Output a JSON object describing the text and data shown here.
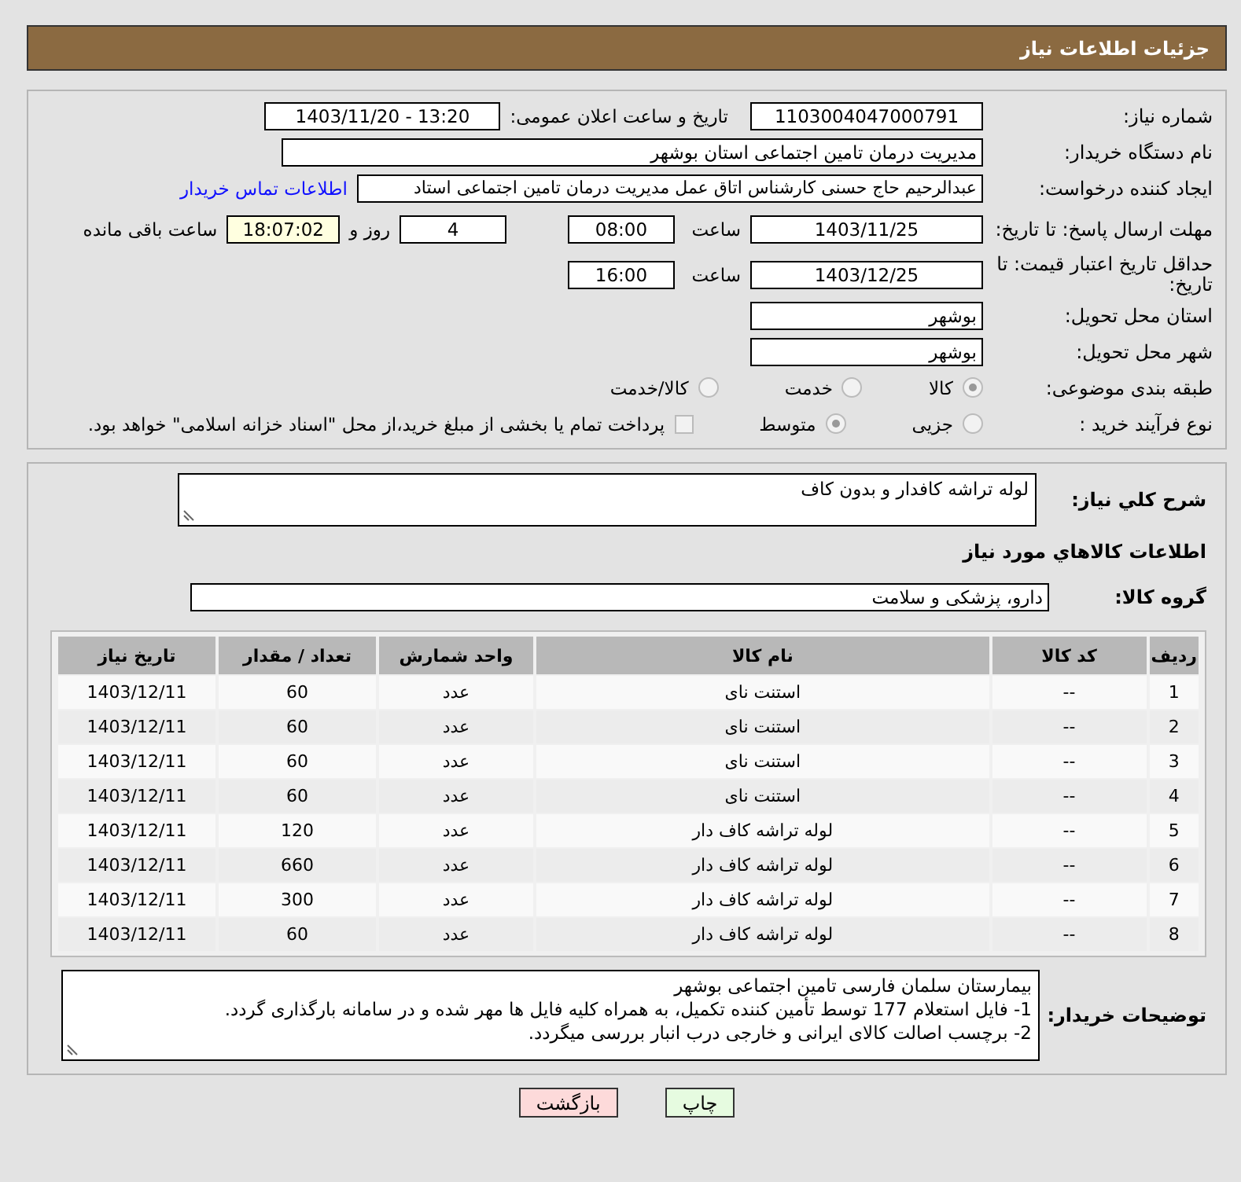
{
  "header": {
    "title": "جزئیات اطلاعات نیاز"
  },
  "form": {
    "need_number": {
      "label": "شماره نیاز:",
      "value": "1103004047000791"
    },
    "announce": {
      "label": "تاریخ و ساعت اعلان عمومی:",
      "value": "1403/11/20 - 13:20"
    },
    "buyer_org": {
      "label": "نام دستگاه خریدار:",
      "value": "مدیریت درمان تامین اجتماعی استان بوشهر"
    },
    "creator": {
      "label": "ایجاد کننده درخواست:",
      "value": "عبدالرحیم حاج حسنی کارشناس اتاق عمل مدیریت درمان تامین اجتماعی استاد",
      "link": "اطلاعات تماس خریدار"
    },
    "deadline": {
      "label": "مهلت ارسال پاسخ: تا تاریخ:",
      "date": "1403/11/25",
      "time_label": "ساعت",
      "time": "08:00",
      "days": "4",
      "days_label": "روز و",
      "remaining": "18:07:02",
      "remaining_label": "ساعت باقی مانده"
    },
    "validity": {
      "label": "حداقل تاریخ اعتبار قیمت: تا تاریخ:",
      "date": "1403/12/25",
      "time_label": "ساعت",
      "time": "16:00"
    },
    "province": {
      "label": "استان محل تحویل:",
      "value": "بوشهر"
    },
    "city": {
      "label": "شهر محل تحویل:",
      "value": "بوشهر"
    },
    "category": {
      "label": "طبقه بندی موضوعی:",
      "options": [
        {
          "label": "کالا",
          "selected": true
        },
        {
          "label": "خدمت",
          "selected": false
        },
        {
          "label": "کالا/خدمت",
          "selected": false
        }
      ]
    },
    "process": {
      "label": "نوع فرآیند خرید :",
      "options": [
        {
          "label": "جزیی",
          "selected": false
        },
        {
          "label": "متوسط",
          "selected": true
        }
      ],
      "treasury": {
        "label": "پرداخت تمام یا بخشی از مبلغ خرید،از محل \"اسناد خزانه اسلامی\" خواهد بود.",
        "checked": false
      }
    }
  },
  "details": {
    "description": {
      "label": "شرح كلي نياز:",
      "value": "لوله تراشه کافدار و بدون کاف"
    },
    "goods_heading": "اطلاعات كالاهاي مورد نياز",
    "group": {
      "label": "گروه کالا:",
      "value": "دارو، پزشکی و سلامت"
    },
    "table": {
      "columns": [
        "ردیف",
        "کد کالا",
        "نام کالا",
        "واحد شمارش",
        "تعداد / مقدار",
        "تاریخ نیاز"
      ],
      "rows": [
        [
          "1",
          "--",
          "استنت نای",
          "عدد",
          "60",
          "1403/12/11"
        ],
        [
          "2",
          "--",
          "استنت نای",
          "عدد",
          "60",
          "1403/12/11"
        ],
        [
          "3",
          "--",
          "استنت نای",
          "عدد",
          "60",
          "1403/12/11"
        ],
        [
          "4",
          "--",
          "استنت نای",
          "عدد",
          "60",
          "1403/12/11"
        ],
        [
          "5",
          "--",
          "لوله تراشه کاف دار",
          "عدد",
          "120",
          "1403/12/11"
        ],
        [
          "6",
          "--",
          "لوله تراشه کاف دار",
          "عدد",
          "660",
          "1403/12/11"
        ],
        [
          "7",
          "--",
          "لوله تراشه کاف دار",
          "عدد",
          "300",
          "1403/12/11"
        ],
        [
          "8",
          "--",
          "لوله تراشه کاف دار",
          "عدد",
          "60",
          "1403/12/11"
        ]
      ]
    },
    "buyer_notes": {
      "label": "توضیحات خریدار:",
      "lines": [
        "بیمارستان سلمان فارسی تامین اجتماعی بوشهر",
        "1- فایل استعلام 177 توسط تأمین کننده تکمیل، به همراه کلیه فایل ها مهر شده و در سامانه بارگذاری گردد.",
        "2- برچسب اصالت کالای ایرانی و خارجی درب انبار بررسی میگردد."
      ]
    }
  },
  "buttons": [
    {
      "kind": "print",
      "label": "چاپ"
    },
    {
      "kind": "back",
      "label": "بازگشت"
    }
  ]
}
